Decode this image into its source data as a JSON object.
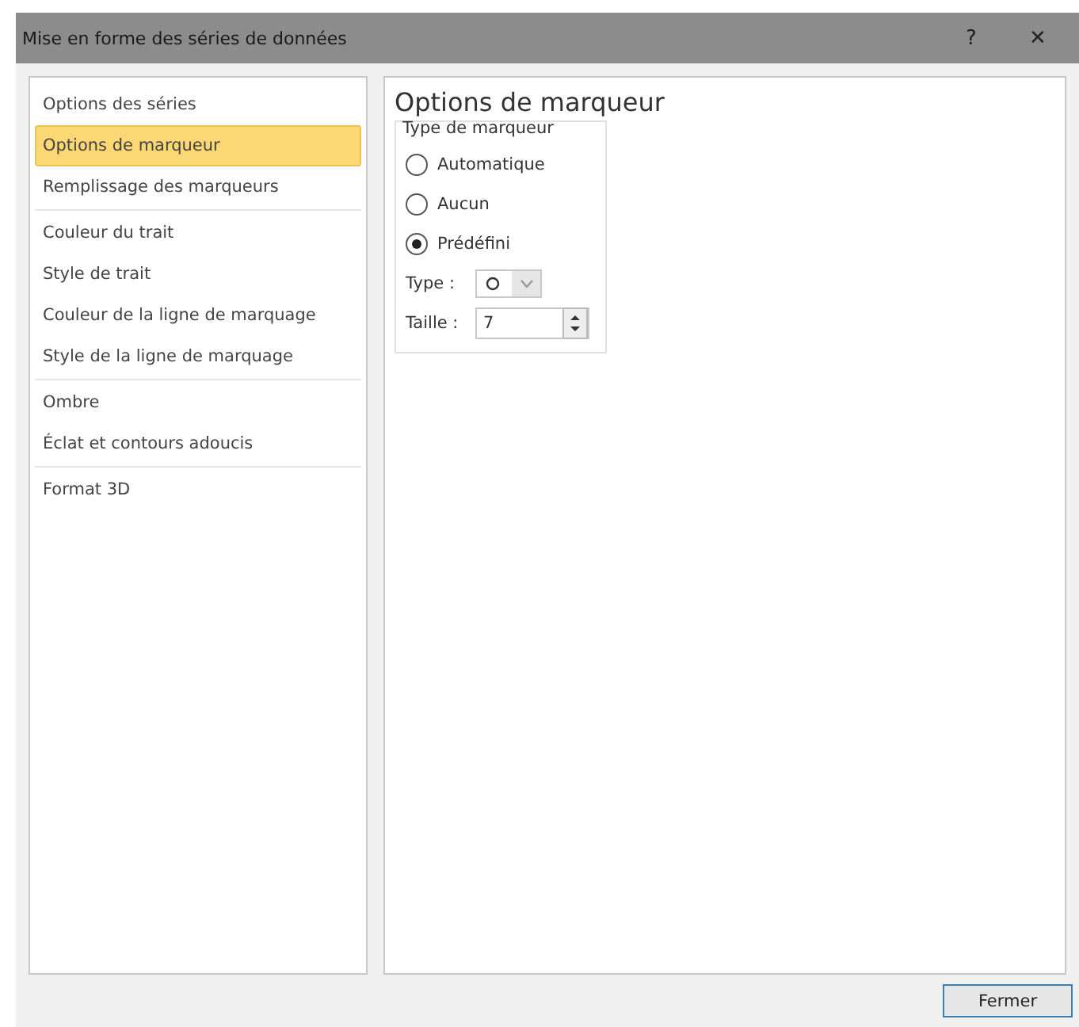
{
  "window": {
    "title": "Mise en forme des séries de données",
    "help": "?",
    "close": "✕"
  },
  "sidebar": {
    "groups": [
      [
        {
          "label": "Options des séries",
          "selected": false
        },
        {
          "label": "Options de marqueur",
          "selected": true
        },
        {
          "label": "Remplissage des marqueurs",
          "selected": false
        }
      ],
      [
        {
          "label": "Couleur du trait",
          "selected": false
        },
        {
          "label": "Style de trait",
          "selected": false
        },
        {
          "label": "Couleur de la ligne de marquage",
          "selected": false
        },
        {
          "label": "Style de la ligne de marquage",
          "selected": false
        }
      ],
      [
        {
          "label": "Ombre",
          "selected": false
        },
        {
          "label": "Éclat et contours adoucis",
          "selected": false
        }
      ],
      [
        {
          "label": "Format 3D",
          "selected": false
        }
      ]
    ]
  },
  "panel": {
    "heading": "Options de marqueur",
    "group_title": "Type de marqueur",
    "radios": [
      {
        "label": "Automatique",
        "selected": false
      },
      {
        "label": "Aucun",
        "selected": false
      },
      {
        "label": "Prédéfini",
        "selected": true
      }
    ],
    "type_label": "Type :",
    "size_label": "Taille :",
    "size_value": "7"
  },
  "buttons": [
    {
      "label": "Fermer"
    }
  ]
}
